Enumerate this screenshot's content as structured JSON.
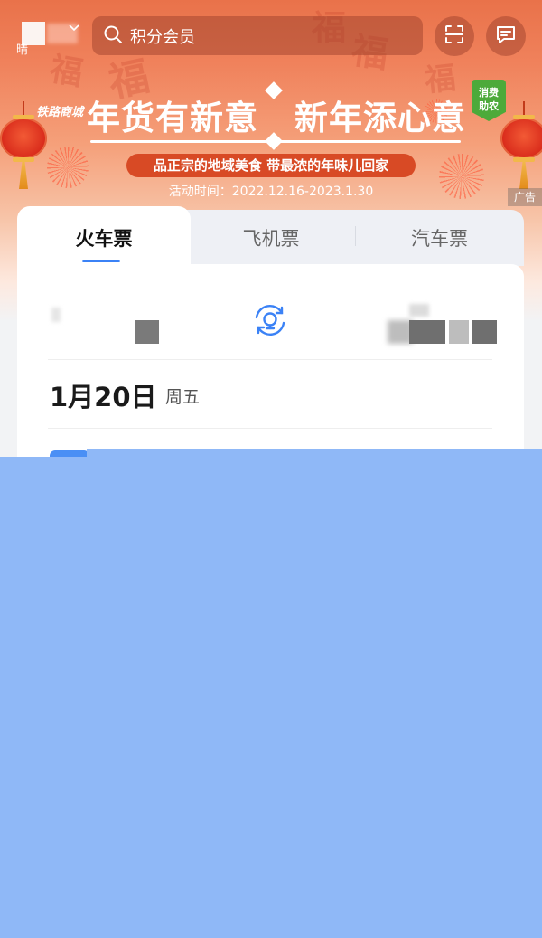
{
  "header": {
    "weather_text": "晴",
    "search_placeholder": "积分会员",
    "icons": {
      "weather": "weather-icon",
      "dropdown": "chevron-down-icon",
      "search": "search-icon",
      "scan": "scan-icon",
      "message": "message-icon"
    }
  },
  "banner": {
    "brand": "铁路商城",
    "slogan_left": "年货有新意",
    "slogan_right": "新年添心意",
    "subtitle": "品正宗的地域美食 带最浓的年味儿回家",
    "activity_time": "活动时间：2022.12.16-2023.1.30",
    "badge": [
      "消费",
      "助农"
    ],
    "ad_label": "广告",
    "bg_glyphs": [
      "福",
      "福",
      "福",
      "福",
      "福"
    ]
  },
  "tabs": [
    {
      "label": "火车票",
      "active": true
    },
    {
      "label": "飞机票",
      "active": false
    },
    {
      "label": "汽车票",
      "active": false
    }
  ],
  "booking": {
    "date": "1月20日",
    "weekday": "周五"
  },
  "colors": {
    "accent": "#3b82f6",
    "overlay": "#8fb8f7",
    "banner_top": "#e9724a",
    "badge_green": "#4caa3a"
  }
}
